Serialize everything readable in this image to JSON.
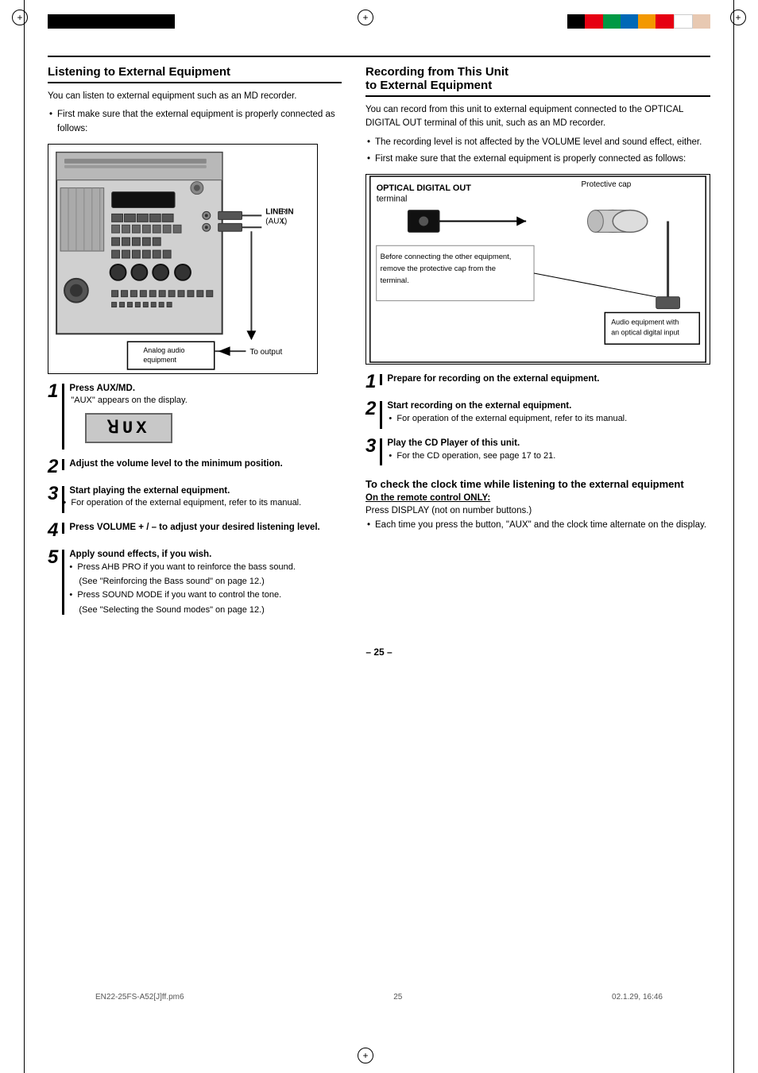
{
  "page": {
    "number": "– 25 –",
    "footer_left": "EN22-25FS-A52[J]ff.pm6",
    "footer_middle": "25",
    "footer_right": "02.1.29, 16:46"
  },
  "left_section": {
    "title": "Listening to External Equipment",
    "intro": "You can listen to external equipment such as an MD recorder.",
    "prereq_bullet": "First make sure that the external equipment is properly connected as follows:",
    "diagram_labels": {
      "line_in": "LINE IN",
      "aux": "(AUX)",
      "analog_audio": "Analog audio equipment",
      "to_output": "To output"
    },
    "steps": [
      {
        "num": "1",
        "main": "Press AUX/MD.",
        "detail": "\"AUX\" appears on the display."
      },
      {
        "num": "2",
        "main": "Adjust the volume level to the minimum position.",
        "detail": ""
      },
      {
        "num": "3",
        "main": "Start playing the external equipment.",
        "detail": "For operation of the external equipment, refer to its manual."
      },
      {
        "num": "4",
        "main": "Press VOLUME + / – to adjust your desired listening level.",
        "detail": ""
      },
      {
        "num": "5",
        "main": "Apply sound effects, if you wish.",
        "bullets": [
          "Press AHB PRO if you want to reinforce the bass sound.",
          "(See \"Reinforcing the Bass sound\" on page 12.)",
          "Press SOUND MODE if you want to control the tone.",
          "(See \"Selecting the Sound modes\" on page 12.)"
        ]
      }
    ]
  },
  "right_section": {
    "title_line1": "Recording from This Unit",
    "title_line2": "to External Equipment",
    "intro": "You can record from this unit to external equipment connected to the OPTICAL DIGITAL OUT terminal of this unit, such as an MD recorder.",
    "bullets": [
      "The recording level is not affected by the VOLUME level and sound effect, either.",
      "First make sure that the external equipment is properly connected as follows:"
    ],
    "diagram_labels": {
      "optical_digital_out": "OPTICAL DIGITAL OUT",
      "terminal": "terminal",
      "protective_cap": "Protective cap",
      "before_connecting": "Before connecting the other equipment, remove the protective cap from the terminal.",
      "audio_equipment": "Audio equipment with an optical digital input"
    },
    "steps": [
      {
        "num": "1",
        "main": "Prepare for recording on the external equipment.",
        "detail": ""
      },
      {
        "num": "2",
        "main": "Start recording on the external equipment.",
        "detail": "For operation of the external equipment, refer to its manual."
      },
      {
        "num": "3",
        "main": "Play the CD Player of this unit.",
        "detail": "For the CD operation, see page 17 to 21."
      }
    ],
    "clock_section": {
      "title": "To check the clock time while listening to the external equipment",
      "on_remote": "On the remote control ONLY:",
      "press_display": "Press DISPLAY (not on number buttons.)",
      "bullet": "Each time you press the button, \"AUX\" and the clock time alternate on the display."
    }
  }
}
